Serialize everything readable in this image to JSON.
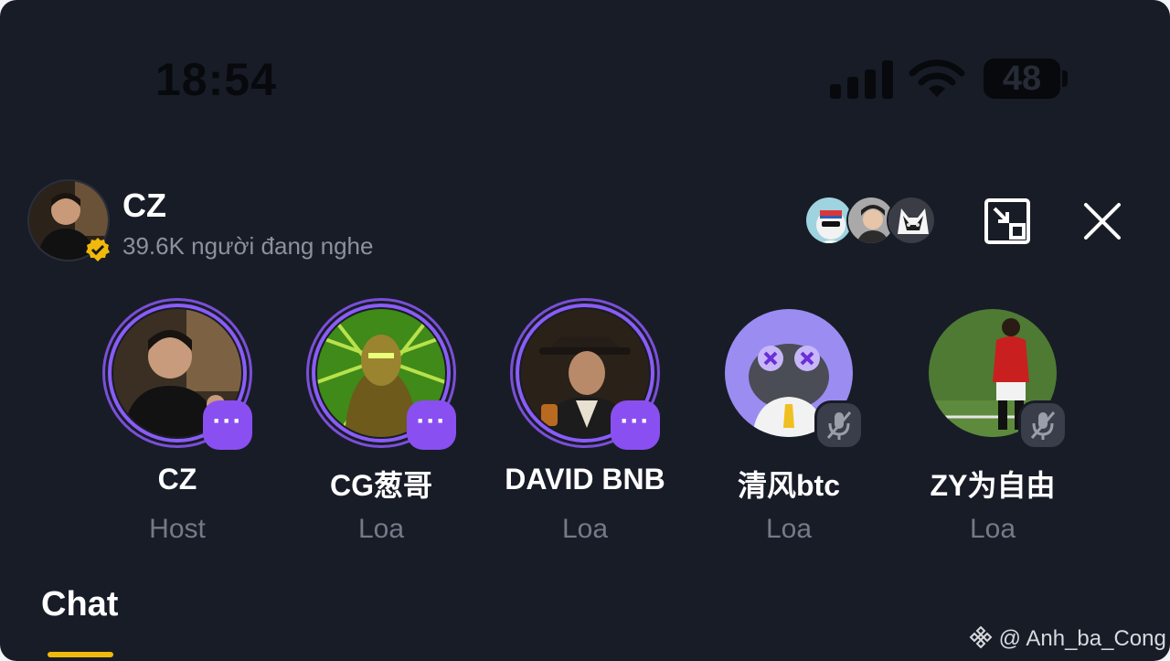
{
  "status_bar": {
    "time": "18:54",
    "battery": "48"
  },
  "header": {
    "host_name": "CZ",
    "listeners": "39.6K người đang nghe",
    "icons": [
      "verified-badge-icon",
      "minimize-icon",
      "close-icon"
    ]
  },
  "speakers": [
    {
      "name": "CZ",
      "role": "Host",
      "badge": "···"
    },
    {
      "name": "CG葱哥",
      "role": "Loa",
      "badge": "···"
    },
    {
      "name": "DAVID BNB",
      "role": "Loa",
      "badge": "···"
    },
    {
      "name": "清风btc",
      "role": "Loa",
      "badge": "muted"
    },
    {
      "name": "ZY为自由",
      "role": "Loa",
      "badge": "muted"
    }
  ],
  "tabs": {
    "chat": "Chat"
  },
  "watermark": "@ Anh_ba_Cong",
  "colors": {
    "background": "#181c27",
    "accent_purple": "#8a4ff0",
    "tab_underline": "#f0b90b",
    "muted_text": "#747a87"
  }
}
